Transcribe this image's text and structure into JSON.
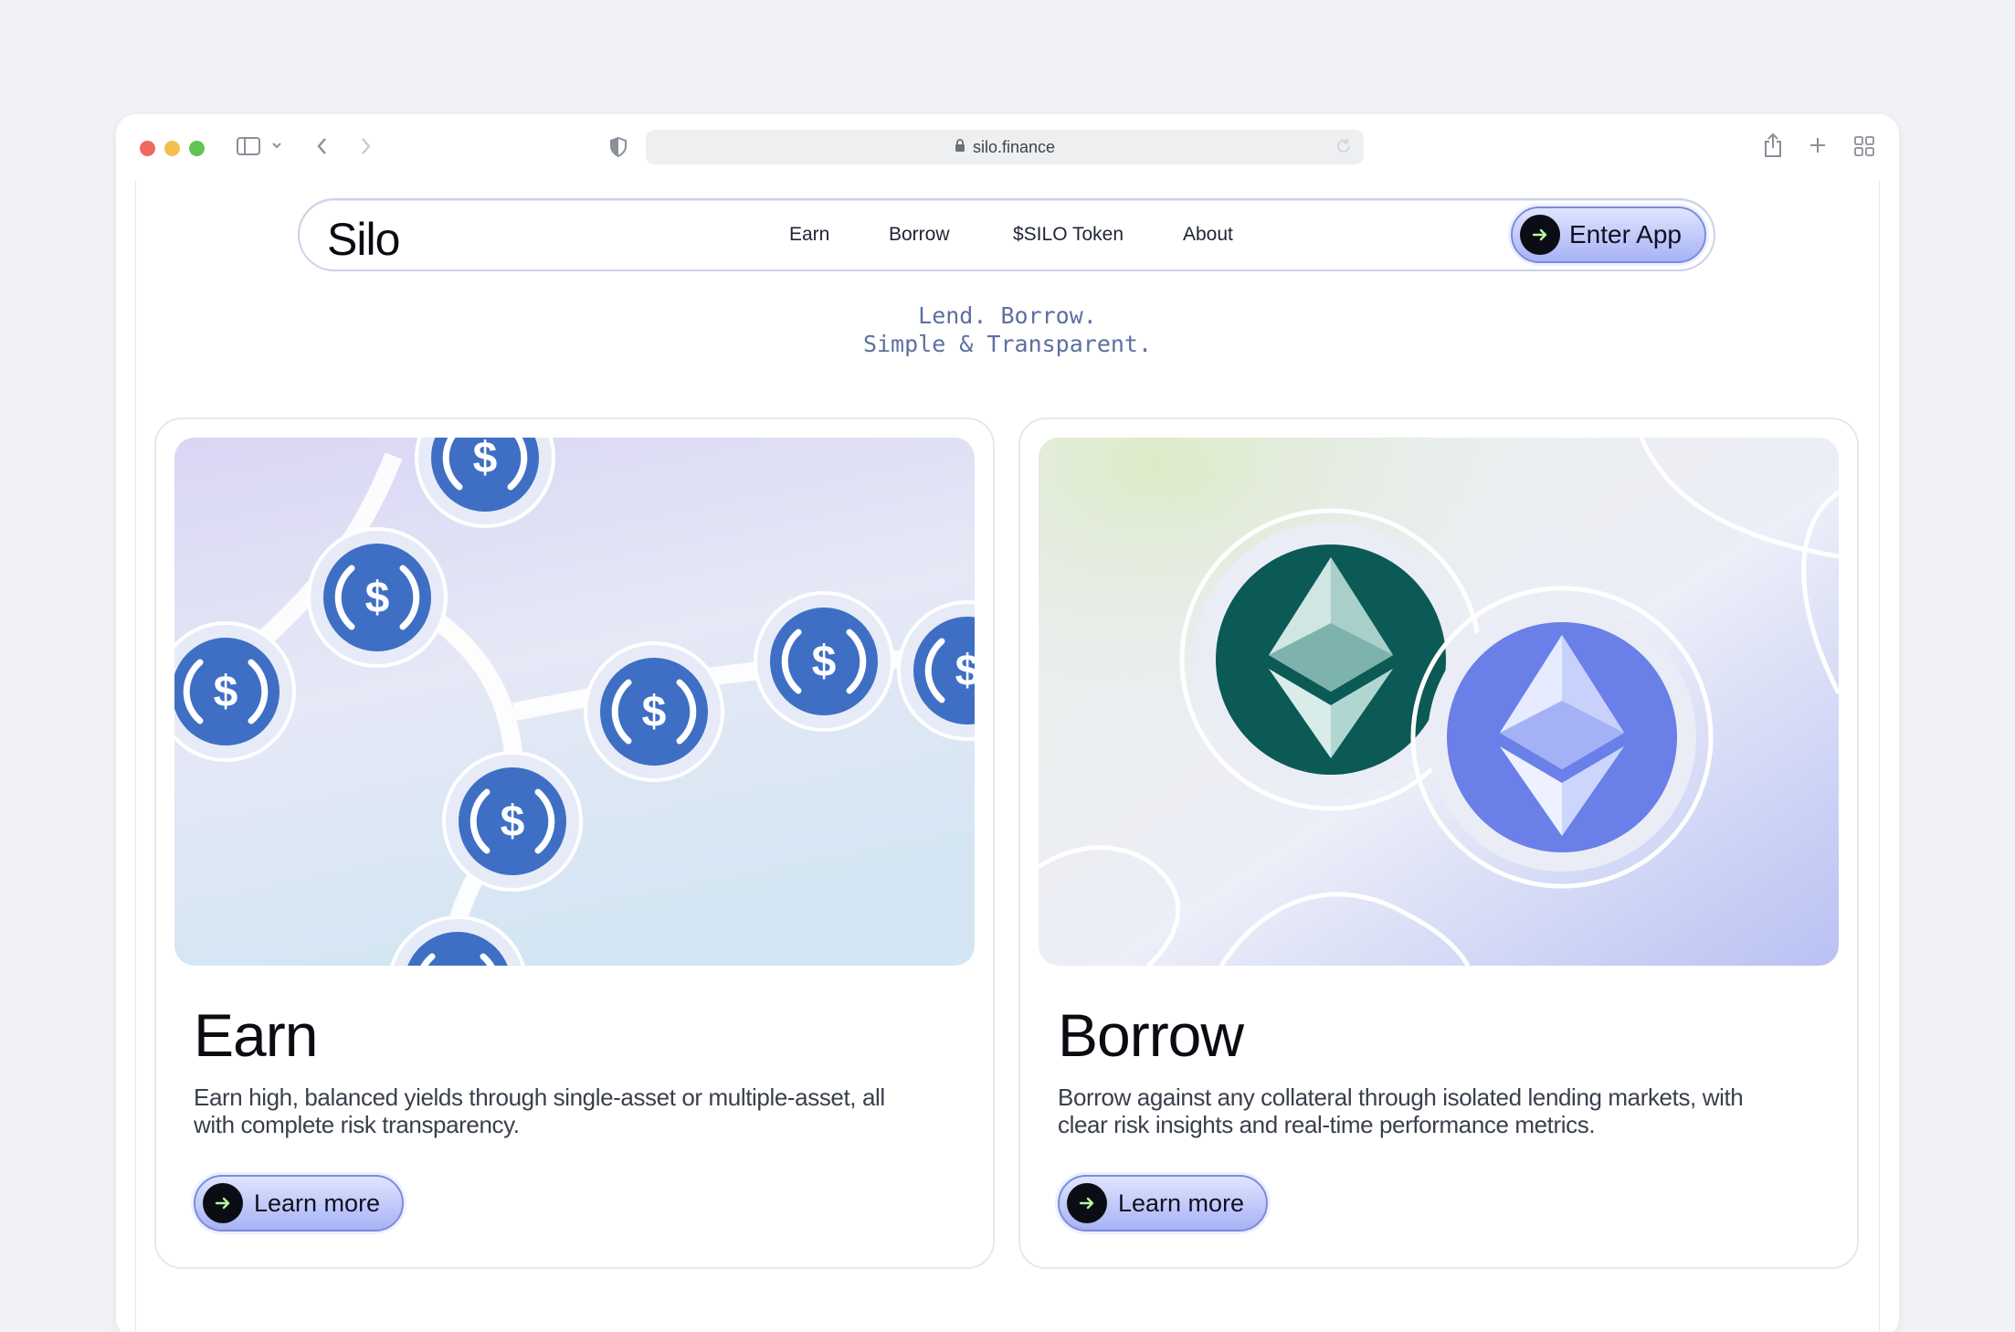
{
  "browser": {
    "url": "silo.finance"
  },
  "nav": {
    "logo": "Silo",
    "links": [
      "Earn",
      "Borrow",
      "$SILO Token",
      "About"
    ],
    "cta": "Enter App"
  },
  "hero": {
    "line1": "Lend. Borrow.",
    "line2": "Simple & Transparent."
  },
  "cards": [
    {
      "title": "Earn",
      "description": "Earn high, balanced yields through single-asset or multiple-asset, all with complete risk transparency.",
      "button": "Learn more",
      "image_icon": "usdc-coin-icon"
    },
    {
      "title": "Borrow",
      "description": "Borrow against any collateral through isolated lending markets, with clear risk insights and real-time performance metrics.",
      "button": "Learn more",
      "image_icon": "ethereum-coin-icon"
    }
  ],
  "colors": {
    "accent_blue": "#3e6fc4",
    "eth_teal": "#0b5a55",
    "eth_blue": "#6a80e8",
    "button_border": "#7c8bdc"
  }
}
